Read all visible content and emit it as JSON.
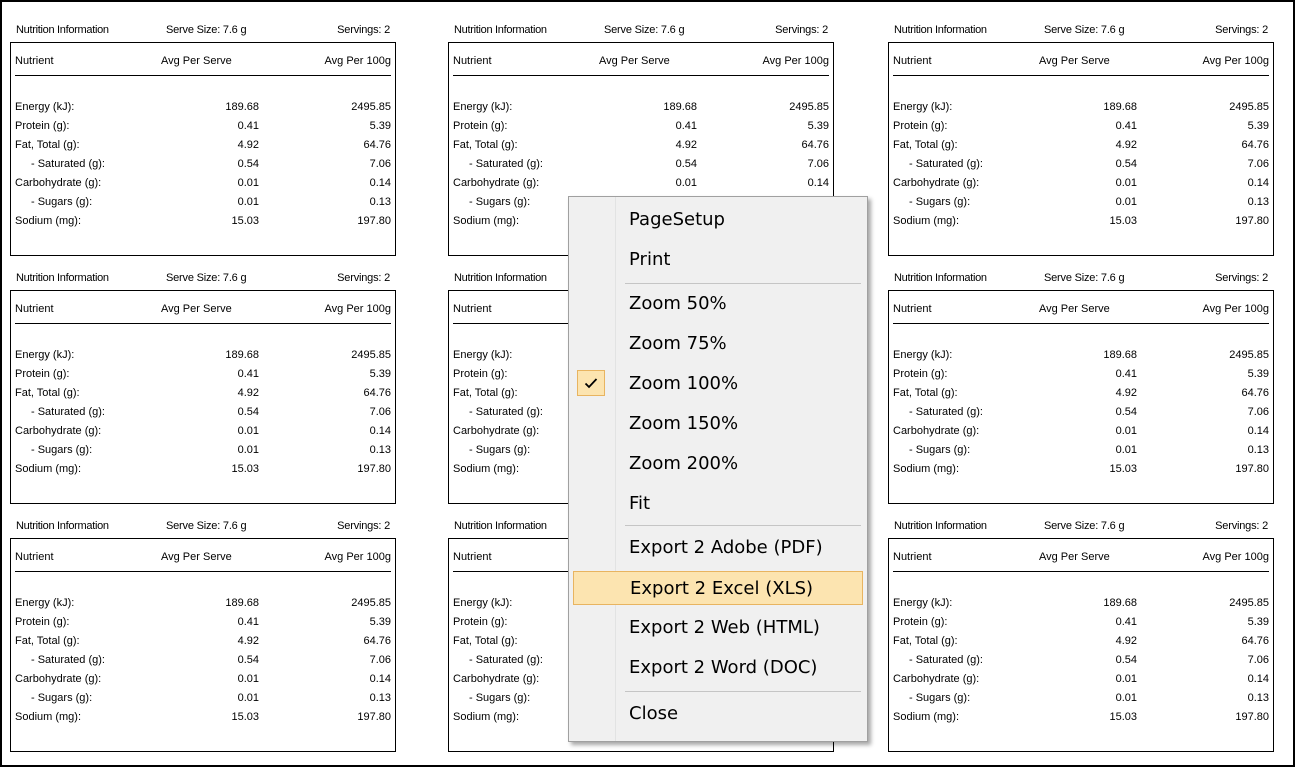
{
  "panel": {
    "title": "Nutrition Information",
    "serve_size": "Serve Size:  7.6 g",
    "servings": "Servings:  2",
    "col_nutrient": "Nutrient",
    "col_per_serve": "Avg Per Serve",
    "col_per_100g": "Avg Per 100g",
    "rows": [
      {
        "label": "Energy (kJ):",
        "per_serve": "189.68",
        "per_100g": "2495.85"
      },
      {
        "label": "Protein (g):",
        "per_serve": "0.41",
        "per_100g": "5.39"
      },
      {
        "label": "Fat, Total (g):",
        "per_serve": "4.92",
        "per_100g": "64.76"
      },
      {
        "label": "- Saturated (g):",
        "per_serve": "0.54",
        "per_100g": "7.06"
      },
      {
        "label": "Carbohydrate (g):",
        "per_serve": "0.01",
        "per_100g": "0.14"
      },
      {
        "label": "- Sugars (g):",
        "per_serve": "0.01",
        "per_100g": "0.13"
      },
      {
        "label": "Sodium (mg):",
        "per_serve": "15.03",
        "per_100g": "197.80"
      }
    ]
  },
  "menu": {
    "items": [
      {
        "label": "PageSetup",
        "checked": false,
        "highlighted": false
      },
      {
        "label": "Print",
        "checked": false,
        "highlighted": false
      },
      {
        "label": "Zoom 50%",
        "checked": false,
        "highlighted": false
      },
      {
        "label": "Zoom 75%",
        "checked": false,
        "highlighted": false
      },
      {
        "label": "Zoom 100%",
        "checked": true,
        "highlighted": false
      },
      {
        "label": "Zoom 150%",
        "checked": false,
        "highlighted": false
      },
      {
        "label": "Zoom 200%",
        "checked": false,
        "highlighted": false
      },
      {
        "label": "Fit",
        "checked": false,
        "highlighted": false
      },
      {
        "label": "Export 2 Adobe (PDF)",
        "checked": false,
        "highlighted": false
      },
      {
        "label": "Export 2 Excel (XLS)",
        "checked": false,
        "highlighted": true
      },
      {
        "label": "Export 2 Web (HTML)",
        "checked": false,
        "highlighted": false
      },
      {
        "label": "Export 2 Word (DOC)",
        "checked": false,
        "highlighted": false
      },
      {
        "label": "Close",
        "checked": false,
        "highlighted": false
      }
    ],
    "check_icon": "checkmark-icon",
    "highlight_color": "#fce4b0",
    "highlight_border": "#e8b460"
  }
}
